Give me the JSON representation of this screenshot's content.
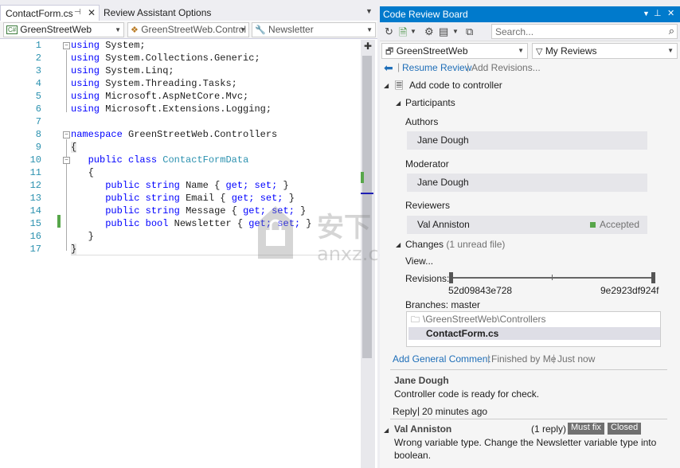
{
  "editor": {
    "tab_active": "ContactForm.cs",
    "tab_second": "Review Assistant Options",
    "nav": {
      "project": "GreenStreetWeb",
      "class": "GreenStreetWeb.Control",
      "member": "Newsletter"
    },
    "line_numbers": [
      "1",
      "2",
      "3",
      "4",
      "5",
      "6",
      "7",
      "8",
      "9",
      "10",
      "11",
      "12",
      "13",
      "14",
      "15",
      "16",
      "17"
    ],
    "code": {
      "l1": "System;",
      "l2": "System.Collections.Generic;",
      "l3": "System.Linq;",
      "l4": "System.Threading.Tasks;",
      "l5": "Microsoft.AspNetCore.Mvc;",
      "l6": "Microsoft.Extensions.Logging;",
      "using_kw": "using",
      "ns_kw": "namespace",
      "ns_name": "GreenStreetWeb.Controllers",
      "open_brace": "{",
      "close_brace": "}",
      "public_kw": "public",
      "class_kw": "class",
      "class_name": "ContactFormData",
      "string_kw": "string",
      "bool_kw": "bool",
      "get_kw": "get;",
      "set_kw": "set;",
      "p1": "Name",
      "p2": "Email",
      "p3": "Message",
      "p4": "Newsletter"
    }
  },
  "review": {
    "title": "Code Review Board",
    "search_placeholder": "Search...",
    "project_combo": "GreenStreetWeb",
    "filter_combo": "My Reviews",
    "resume": "Resume Review",
    "add_revisions": "Add Revisions...",
    "review_title": "Add code to controller",
    "participants": "Participants",
    "authors_label": "Authors",
    "author": "Jane Dough",
    "moderator_label": "Moderator",
    "moderator": "Jane Dough",
    "reviewers_label": "Reviewers",
    "reviewer": "Val Anniston",
    "reviewer_status": "Accepted",
    "changes_label": "Changes",
    "changes_note": "(1 unread file)",
    "view": "View...",
    "revisions_label": "Revisions:",
    "rev_from": "52d09843e728",
    "rev_to": "9e2923df924f",
    "branches_label": "Branches:",
    "branch": "master",
    "folder": "\\GreenStreetWeb\\Controllers",
    "file": "ContactForm.cs",
    "add_general_comment": "Add General Comment",
    "finished_by_me": "Finished by Me",
    "just_now": "Just now",
    "comment1": {
      "author": "Jane Dough",
      "text": "Controller code is ready for check.",
      "reply": "Reply",
      "time": "20 minutes ago"
    },
    "comment2": {
      "author": "Val Anniston",
      "replies": "(1 reply)",
      "badge1": "Must fix",
      "badge2": "Closed",
      "text1": "Wrong variable type. Change the Newsletter variable type into",
      "text2": "boolean."
    }
  },
  "watermark": {
    "text": "anxz.com"
  },
  "colors": {
    "accent": "#007acc",
    "keyword": "#0000ff",
    "type": "#2b91af",
    "link": "#1e6eb8",
    "green": "#57a64a"
  }
}
